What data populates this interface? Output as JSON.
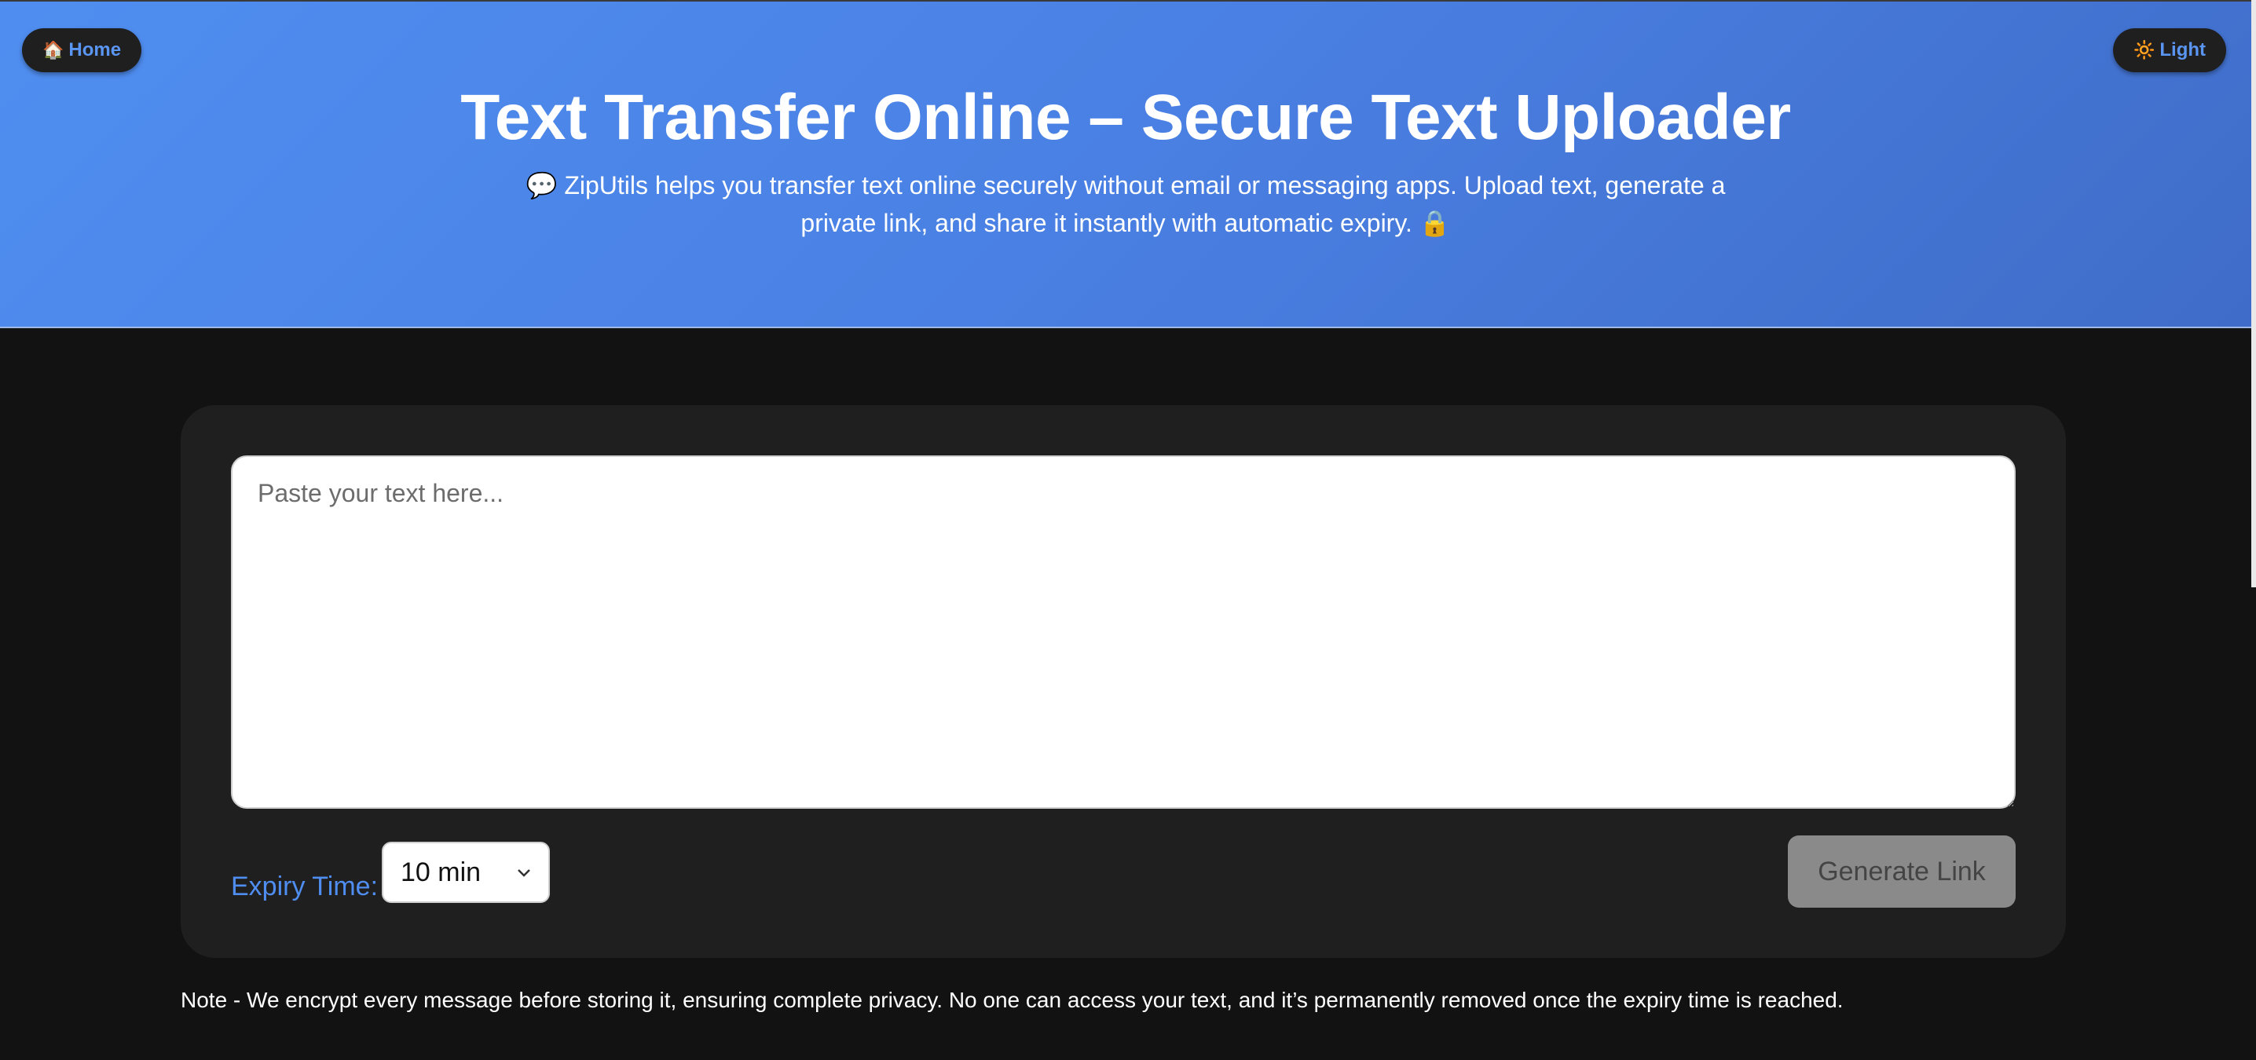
{
  "nav": {
    "home_icon": "🏠",
    "home_label": "Home",
    "theme_icon": "🔆",
    "theme_label": "Light"
  },
  "hero": {
    "title": "Text Transfer Online – Secure Text Uploader",
    "description": "💬 ZipUtils helps you transfer text online securely without email or messaging apps. Upload text, generate a private link, and share it instantly with automatic expiry. 🔒"
  },
  "form": {
    "textarea_value": "",
    "textarea_placeholder": "Paste your text here...",
    "expiry_label": "Expiry Time:",
    "expiry_selected": "10 min",
    "generate_label": "Generate Link"
  },
  "note": "Note - We encrypt every message before storing it, ensuring complete privacy. No one can access your text, and it’s permanently removed once the expiry time is reached.",
  "colors": {
    "accent": "#4f8ef0",
    "hero_gradient_start": "#4f8ef0",
    "hero_gradient_end": "#3f6cc8",
    "background": "#121212",
    "card": "#1f1f1f",
    "button_disabled": "#8a8a8a"
  },
  "icons": {
    "home": "house-icon",
    "theme": "sun-icon",
    "select": "chevron-down-icon"
  }
}
